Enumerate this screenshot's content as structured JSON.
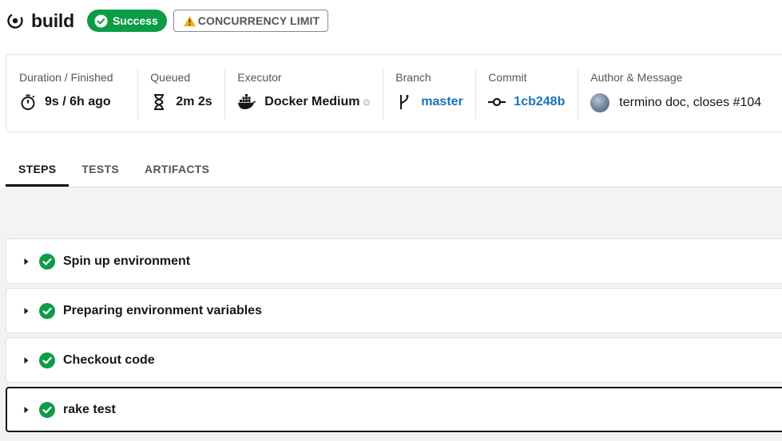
{
  "job": {
    "title": "build",
    "status": "Success",
    "concurrency_badge": "CONCURRENCY LIMIT"
  },
  "summary": {
    "duration": {
      "label": "Duration / Finished",
      "value": "9s / 6h ago",
      "icon": "stopwatch-icon"
    },
    "queued": {
      "label": "Queued",
      "value": "2m 2s",
      "icon": "hourglass-icon"
    },
    "executor": {
      "label": "Executor",
      "value": "Docker Medium",
      "icon": "docker-icon"
    },
    "branch": {
      "label": "Branch",
      "value": "master",
      "icon": "branch-icon"
    },
    "commit": {
      "label": "Commit",
      "value": "1cb248b",
      "icon": "commit-icon"
    },
    "author": {
      "label": "Author & Message",
      "value": "termino doc, closes #104"
    }
  },
  "tabs": [
    {
      "label": "STEPS",
      "active": true
    },
    {
      "label": "TESTS",
      "active": false
    },
    {
      "label": "ARTIFACTS",
      "active": false
    }
  ],
  "steps": [
    {
      "name": "Spin up environment",
      "status": "success"
    },
    {
      "name": "Preparing environment variables",
      "status": "success"
    },
    {
      "name": "Checkout code",
      "status": "success"
    },
    {
      "name": "rake test",
      "status": "success",
      "selected": true
    }
  ],
  "colors": {
    "success": "#0d9c46",
    "link": "#1a73b8",
    "warning": "#f2b01e"
  }
}
